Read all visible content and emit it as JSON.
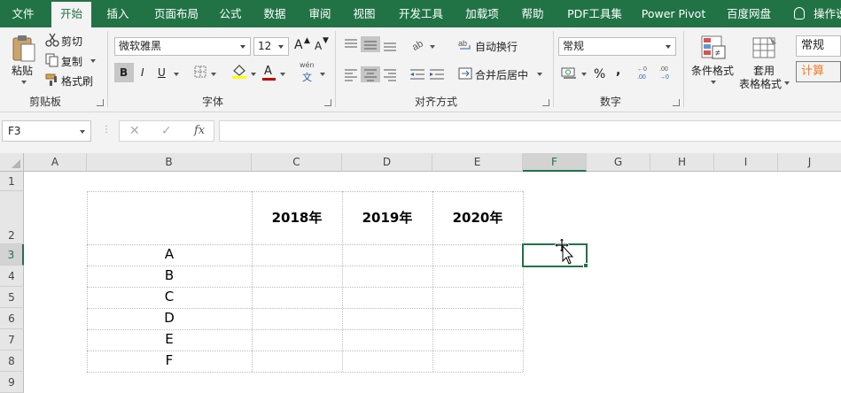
{
  "ribbon_tabs": [
    "文件",
    "开始",
    "插入",
    "页面布局",
    "公式",
    "数据",
    "审阅",
    "视图",
    "开发工具",
    "加载项",
    "帮助",
    "PDF工具集",
    "Power Pivot",
    "百度网盘"
  ],
  "tell_me": "操作说",
  "clipboard": {
    "paste": "粘贴",
    "cut": "剪切",
    "copy": "复制",
    "format_painter": "格式刷",
    "group": "剪贴板"
  },
  "font": {
    "name": "微软雅黑",
    "size": "12",
    "bold": "B",
    "italic": "I",
    "underline": "U",
    "grow": "A",
    "shrink": "A",
    "font_color": "A",
    "phonetic": "wén",
    "phonetic_char": "文",
    "group": "字体"
  },
  "alignment": {
    "wrap_text": "自动换行",
    "merge_center": "合并后居中",
    "group": "对齐方式"
  },
  "number": {
    "format": "常规",
    "percent": "%",
    "comma": ",",
    "group": "数字",
    "inc_dec": ".00→.0",
    "dec_dec": ".0→.00"
  },
  "styles": {
    "conditional_format": "条件格式",
    "table_format_line1": "套用",
    "table_format_line2": "表格格式",
    "style_normal": "常规",
    "style_calc": "计算"
  },
  "formula_bar": {
    "name_box": "F3",
    "cancel": "✕",
    "enter": "✓",
    "fx": "fx",
    "formula": ""
  },
  "columns": [
    "A",
    "B",
    "C",
    "D",
    "E",
    "F",
    "G",
    "H",
    "I",
    "J"
  ],
  "rows": [
    "1",
    "2",
    "3",
    "4",
    "5",
    "6",
    "7",
    "8",
    "9"
  ],
  "selected_cell": "F3",
  "table": {
    "headers": [
      "",
      "2018年",
      "2019年",
      "2020年"
    ],
    "row_labels": [
      "A",
      "B",
      "C",
      "D",
      "E",
      "F"
    ]
  },
  "colors": {
    "accent": "#217346",
    "ribbon_bg": "#f3f3f3",
    "header_bg": "#e6e6e6",
    "style_calc_text": "#f07c22",
    "font_color_bar": "#c00000",
    "fill_color_bar": "#ffff00"
  }
}
